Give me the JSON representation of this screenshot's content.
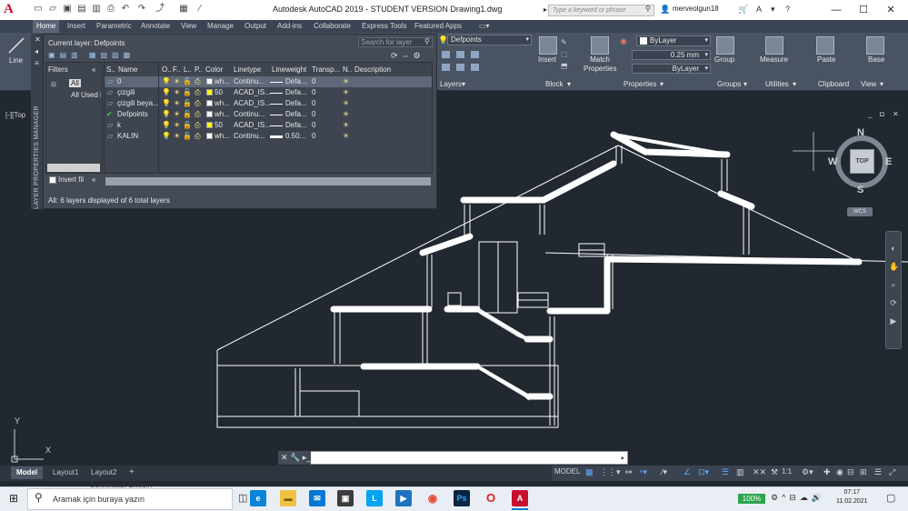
{
  "titlebar": {
    "app_logo": "A",
    "title": "Autodesk AutoCAD 2019 - STUDENT VERSION        Drawing1.dwg",
    "search_placeholder": "Type a keyword or phrase",
    "username": "merveolgun18",
    "minimize": "—",
    "maximize": "☐",
    "close": "✕"
  },
  "ribbon_tabs": [
    "Home",
    "Insert",
    "Parametric",
    "Annotate",
    "View",
    "Manage",
    "Output",
    "Add-ins",
    "Collaborate",
    "Express Tools",
    "Featured Apps"
  ],
  "ribbon": {
    "line_label": "Line",
    "current_layer_combo": "Defpoints",
    "layers_panel": "Layers",
    "insert_label": "Insert",
    "block_panel": "Block",
    "match_properties_label": "Match\nProperties",
    "color_combo": "ByLayer",
    "lineweight_combo": "0.25 mm",
    "linetype_combo": "ByLayer",
    "properties_panel": "Properties",
    "group_label": "Group",
    "groups_panel": "Groups",
    "measure_label": "Measure",
    "utilities_panel": "Utilities",
    "paste_label": "Paste",
    "clipboard_panel": "Clipboard",
    "base_label": "Base",
    "view_panel": "View"
  },
  "layer_palette": {
    "side_title": "LAYER PROPERTIES MANAGER",
    "current_layer": "Current layer: Defpoints",
    "search_placeholder": "Search for layer",
    "filters_label": "Filters",
    "tree_all": "All",
    "tree_all_used": "All Used Layers",
    "invert_filter": "Invert fil",
    "status": "All: 6 layers displayed of 6 total layers",
    "headers": [
      "S..",
      "Name",
      "O..",
      "F..",
      "L..",
      "P..",
      "Color",
      "Linetype",
      "Lineweight",
      "Transp...",
      "N..",
      "Description"
    ],
    "layers": [
      {
        "name": "0",
        "color_name": "wh...",
        "color": "#ffffff",
        "linetype": "Continu...",
        "lineweight": "Defa...",
        "transparency": "0",
        "current": false
      },
      {
        "name": "çizgili",
        "color_name": "50",
        "color": "#ffff00",
        "linetype": "ACAD_IS...",
        "lineweight": "Defa...",
        "transparency": "0",
        "current": false
      },
      {
        "name": "çizgili beya...",
        "color_name": "wh...",
        "color": "#ffffff",
        "linetype": "ACAD_IS...",
        "lineweight": "Defa...",
        "transparency": "0",
        "current": false
      },
      {
        "name": "Defpoints",
        "color_name": "wh...",
        "color": "#ffffff",
        "linetype": "Continu...",
        "lineweight": "Defa...",
        "transparency": "0",
        "current": true
      },
      {
        "name": "k",
        "color_name": "50",
        "color": "#ffff00",
        "linetype": "ACAD_IS...",
        "lineweight": "Defa...",
        "transparency": "0",
        "current": false
      },
      {
        "name": "KALIN",
        "color_name": "wh...",
        "color": "#ffffff",
        "linetype": "Continu...",
        "lineweight": "0.50...",
        "transparency": "0",
        "current": false
      }
    ]
  },
  "viewport_label": "[-][Top",
  "viewcube": {
    "n": "N",
    "s": "S",
    "e": "E",
    "w": "W",
    "top": "TOP",
    "wcs": "WCS"
  },
  "ucs": {
    "x": "X",
    "y": "Y"
  },
  "command_line": {
    "prompt": "✕ 🔧 ▸_"
  },
  "layout_tabs": [
    "Model",
    "Layout1",
    "Layout2",
    "+"
  ],
  "status": {
    "model": "MODEL",
    "scale": "1:1"
  },
  "taskbar": {
    "search_placeholder": "Aramak için buraya yazın",
    "battery": "100%",
    "time": "07:17",
    "date": "11.02.2021",
    "tooltip": "Screencast Ekleyin"
  }
}
